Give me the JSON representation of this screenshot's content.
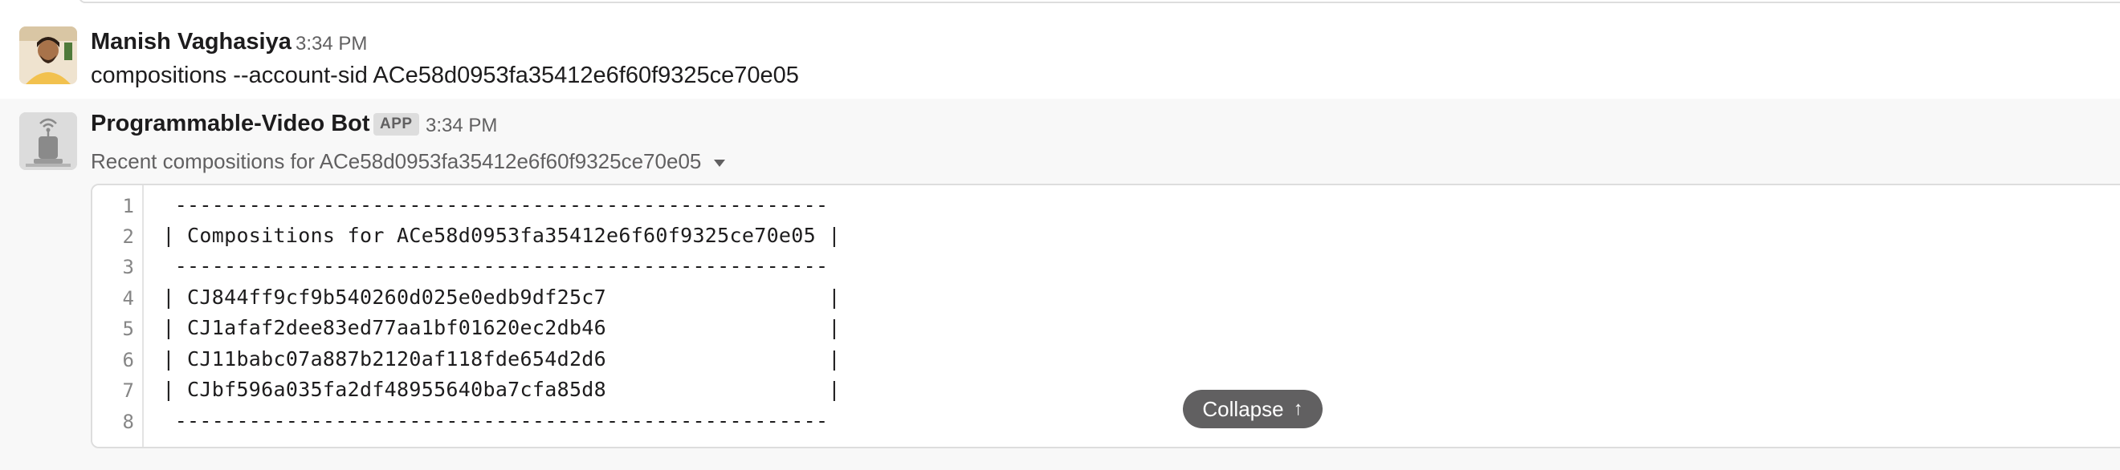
{
  "messages": [
    {
      "sender": "Manish Vaghasiya",
      "time": "3:34 PM",
      "text": "compositions --account-sid ACe58d0953fa35412e6f60f9325ce70e05"
    },
    {
      "sender": "Programmable-Video Bot",
      "badge": "APP",
      "time": "3:34 PM",
      "attachment_title": "Recent compositions for ACe58d0953fa35412e6f60f9325ce70e05",
      "code_lines": [
        "  -----------------------------------------------------",
        " | Compositions for ACe58d0953fa35412e6f60f9325ce70e05 |",
        "  -----------------------------------------------------",
        " | CJ844ff9cf9b540260d025e0edb9df25c7                  |",
        " | CJ1afaf2dee83ed77aa1bf01620ec2db46                  |",
        " | CJ11babc07a887b2120af118fde654d2d6                  |",
        " | CJbf596a035fa2df48955640ba7cfa85d8                  |",
        "  -----------------------------------------------------"
      ],
      "line_numbers": [
        "1",
        "2",
        "3",
        "4",
        "5",
        "6",
        "7",
        "8"
      ],
      "collapse_label": "Collapse"
    }
  ],
  "icons": {
    "caret": "caret-down-icon",
    "collapse_arrow": "arrow-up-icon"
  }
}
